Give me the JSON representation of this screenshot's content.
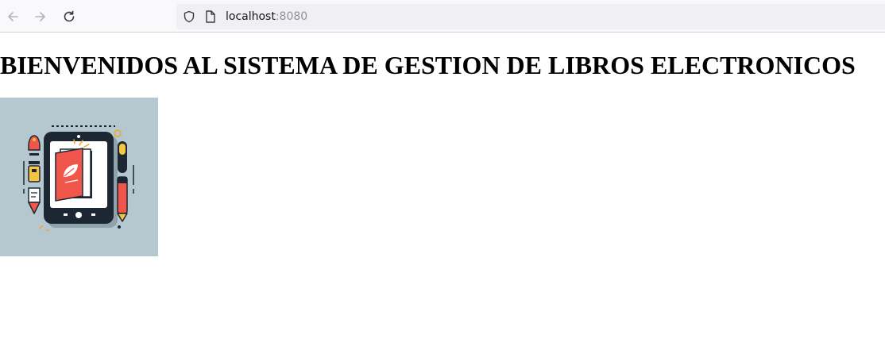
{
  "browser": {
    "url_host": "localhost",
    "url_port": ":8080"
  },
  "page": {
    "title": "BIENVENIDOS AL SISTEMA DE GESTION DE LIBROS ELECTRONICOS",
    "image": {
      "background_color": "#b6c8cf",
      "accent_color": "#f0574a",
      "frame_color": "#1d2733"
    }
  }
}
